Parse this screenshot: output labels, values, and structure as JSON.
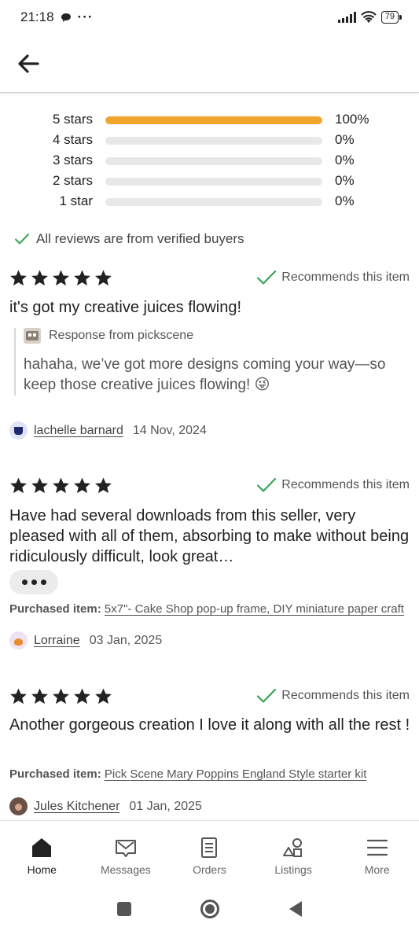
{
  "status_bar": {
    "time": "21:18",
    "more": "···",
    "battery": "79"
  },
  "histogram": {
    "rows": [
      {
        "label": "5 stars",
        "percent": "100%",
        "fraction": 1.0
      },
      {
        "label": "4 stars",
        "percent": "0%",
        "fraction": 0
      },
      {
        "label": "3 stars",
        "percent": "0%",
        "fraction": 0
      },
      {
        "label": "2 stars",
        "percent": "0%",
        "fraction": 0
      },
      {
        "label": "1 star",
        "percent": "0%",
        "fraction": 0
      }
    ],
    "fill_color": "#f1a52d"
  },
  "verified_text": "All reviews are from verified buyers",
  "accent_green": "#3aa35a",
  "reviews": [
    {
      "rating": 5,
      "recommends": "Recommends this item",
      "text": "it's got my creative juices flowing!",
      "response_from": "Response from pickscene",
      "response_text": "hahaha, we’ve got more designs coming your way—so keep those creative juices flowing! 😜",
      "author": "lachelle barnard",
      "date": "14 Nov, 2024"
    },
    {
      "rating": 5,
      "recommends": "Recommends this item",
      "text": "Have had several downloads from this seller, very pleased with all of them, absorbing to make without being ridiculously difficult, look great…",
      "purchased_label": "Purchased item:",
      "purchased_item": "5x7\"- Cake Shop pop-up frame, DIY miniature paper craft",
      "author": "Lorraine",
      "date": "03 Jan, 2025"
    },
    {
      "rating": 5,
      "recommends": "Recommends this item",
      "text": "Another gorgeous creation I love it along with all the rest !",
      "purchased_label": "Purchased item:",
      "purchased_item": "Pick Scene Mary Poppins England Style starter kit",
      "author": "Jules Kitchener",
      "date": "01 Jan, 2025"
    }
  ],
  "bottom_nav": [
    {
      "label": "Home",
      "icon": "home-icon",
      "active": true
    },
    {
      "label": "Messages",
      "icon": "messages-icon",
      "active": false
    },
    {
      "label": "Orders",
      "icon": "orders-icon",
      "active": false
    },
    {
      "label": "Listings",
      "icon": "listings-icon",
      "active": false
    },
    {
      "label": "More",
      "icon": "menu-icon",
      "active": false
    }
  ]
}
